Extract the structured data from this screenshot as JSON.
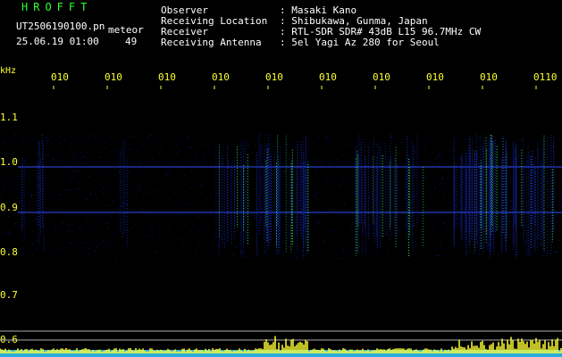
{
  "header": {
    "brand": "HROFFT",
    "filename": "UT2506190100.pn",
    "datetime": "25.06.19 01:00",
    "type_label": "meteor",
    "count": "49"
  },
  "station": {
    "labels": [
      "Observer",
      "Receiving Location",
      "Receiver",
      "Receiving Antenna"
    ],
    "values": [
      ": Masaki Kano",
      ": Shibukawa, Gunma, Japan",
      ": RTL-SDR SDR# 43dB L15 96.7MHz CW",
      ": 5el Yagi Az 280 for Seoul"
    ]
  },
  "time_axis": {
    "ticks": [
      "010",
      "010",
      "010",
      "010",
      "010",
      "010",
      "010",
      "010",
      "010",
      "0110"
    ]
  },
  "freq_axis": {
    "unit": "kHz",
    "ticks": [
      "1.1",
      "1.0",
      "0.9",
      "0.8",
      "0.7",
      "0.6"
    ]
  },
  "colors": {
    "brand": "#2fff2f",
    "tick_labels": "#ffff33",
    "signal_low": "#1a2fd0",
    "signal_high": "#30ff80",
    "level_trace": "#ffff33",
    "level_base": "#33ccff"
  }
}
